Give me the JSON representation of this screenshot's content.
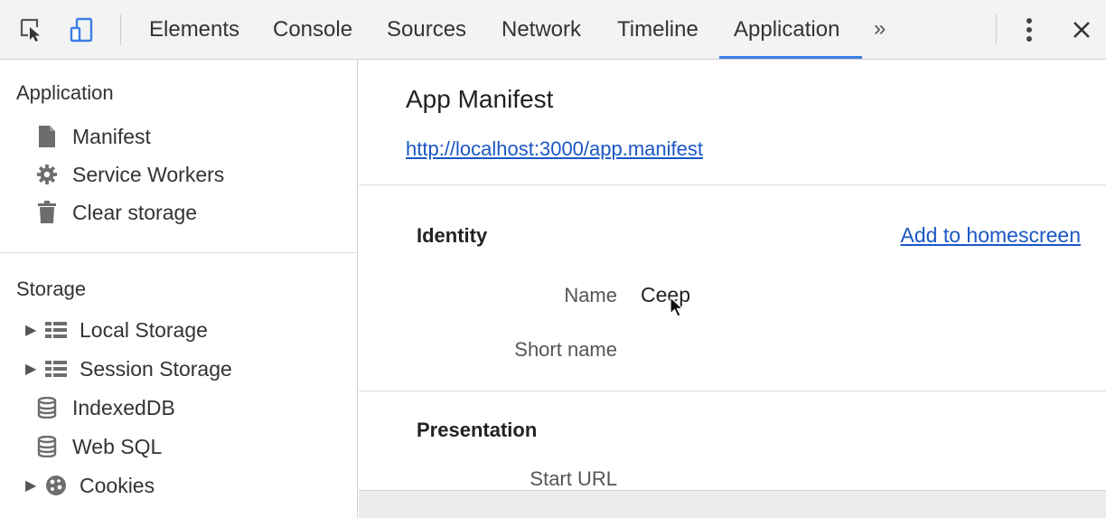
{
  "toolbar": {
    "icons": [
      "inspect-icon",
      "device-mode-icon"
    ],
    "tabs": [
      {
        "label": "Elements"
      },
      {
        "label": "Console"
      },
      {
        "label": "Sources"
      },
      {
        "label": "Network"
      },
      {
        "label": "Timeline"
      },
      {
        "label": "Application",
        "active": true
      }
    ],
    "more_tabs": "»",
    "menu_icon": "kebab-menu-icon",
    "close_icon": "close-icon"
  },
  "sidebar": {
    "application_section": {
      "title": "Application",
      "items": [
        {
          "label": "Manifest",
          "icon": "document-icon"
        },
        {
          "label": "Service Workers",
          "icon": "gear-icon"
        },
        {
          "label": "Clear storage",
          "icon": "trash-icon"
        }
      ]
    },
    "storage_section": {
      "title": "Storage",
      "items": [
        {
          "label": "Local Storage",
          "icon": "grid-icon",
          "expandable": true
        },
        {
          "label": "Session Storage",
          "icon": "grid-icon",
          "expandable": true
        },
        {
          "label": "IndexedDB",
          "icon": "database-icon",
          "expandable": false
        },
        {
          "label": "Web SQL",
          "icon": "database-icon",
          "expandable": false
        },
        {
          "label": "Cookies",
          "icon": "cookie-icon",
          "expandable": true
        }
      ]
    }
  },
  "main": {
    "title": "App Manifest",
    "manifest_url": "http://localhost:3000/app.manifest",
    "identity": {
      "heading": "Identity",
      "action": "Add to homescreen",
      "fields": [
        {
          "label": "Name",
          "value": "Ceep"
        },
        {
          "label": "Short name",
          "value": ""
        }
      ]
    },
    "presentation": {
      "heading": "Presentation",
      "fields": [
        {
          "label": "Start URL",
          "value": ""
        }
      ]
    }
  },
  "colors": {
    "accent": "#3b7de4",
    "link": "#1a57c4",
    "toolbar_bg": "#f3f3f3"
  }
}
